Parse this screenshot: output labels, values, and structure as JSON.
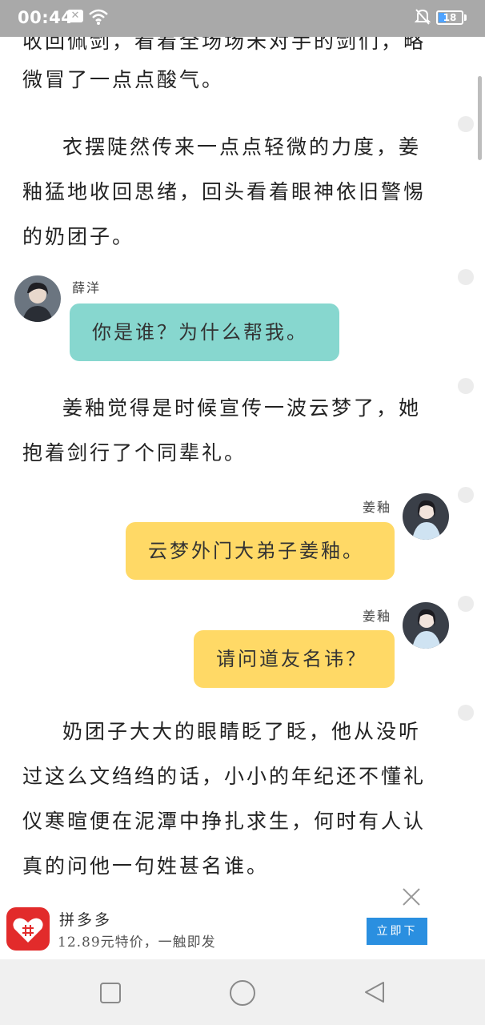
{
  "status_bar": {
    "time": "00:44",
    "battery": "18",
    "notification_icon": "close-box-icon",
    "wifi_icon": "wifi-icon",
    "silent_icon": "bell-off-icon"
  },
  "reader": {
    "para_top_cut": "收回佩剑，看着全场场未对手的剑们，略",
    "para_top": "微冒了一点点酸气。",
    "para_1": "衣摆陡然传来一点点轻微的力度，姜釉猛地收回思绪，回头看着眼神依旧警惕的奶团子。",
    "chat_1": {
      "speaker": "薛洋",
      "text": "你是谁？为什么帮我。",
      "color": "#87d7cf"
    },
    "para_2": "姜釉觉得是时候宣传一波云梦了，她抱着剑行了个同辈礼。",
    "chat_2": {
      "speaker": "姜釉",
      "text": "云梦外门大弟子姜釉。",
      "color": "#ffd966"
    },
    "chat_3": {
      "speaker": "姜釉",
      "text": "请问道友名讳？",
      "color": "#ffd966"
    },
    "para_3": "奶团子大大的眼睛眨了眨，他从没听过这么文绉绉的话，小小的年纪还不懂礼仪寒暄便在泥潭中挣扎求生，何时有人认真的问他一句姓甚名谁。"
  },
  "ad": {
    "title": "拼多多",
    "description": "12.89元特价，一触即发",
    "button_label": "立即下",
    "brand_color": "#e22b2b"
  },
  "nav": {
    "recents": "square-icon",
    "home": "circle-icon",
    "back": "triangle-back-icon"
  }
}
